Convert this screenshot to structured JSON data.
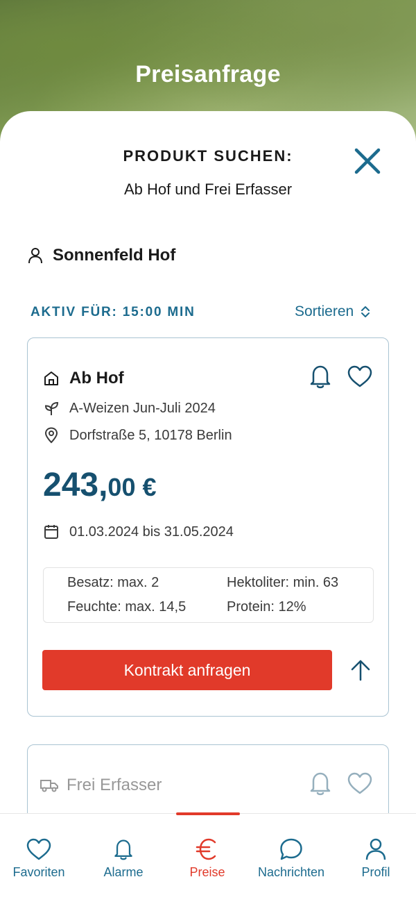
{
  "header": {
    "title": "Preisanfrage"
  },
  "search": {
    "heading": "PRODUKT SUCHEN:",
    "subtitle": "Ab Hof und Frei Erfasser"
  },
  "farm": {
    "name": "Sonnenfeld Hof"
  },
  "status": {
    "active_label": "AKTIV FÜR: 15:00 MIN",
    "sort_label": "Sortieren"
  },
  "offers": [
    {
      "title": "Ab Hof",
      "product": "A-Weizen Jun-Juli 2024",
      "address": "Dorfstraße 5, 10178 Berlin",
      "price_main": "243,",
      "price_cents": "00 €",
      "period": "01.03.2024 bis 31.05.2024",
      "specs": [
        "Besatz: max. 2",
        "Hektoliter: min. 63",
        "Feuchte: max. 14,5",
        "Protein: 12%"
      ],
      "cta": "Kontrakt anfragen"
    },
    {
      "title": "Frei Erfasser"
    }
  ],
  "nav": {
    "items": [
      {
        "label": "Favoriten",
        "icon": "heart-icon"
      },
      {
        "label": "Alarme",
        "icon": "bell-icon"
      },
      {
        "label": "Preise",
        "icon": "euro-icon"
      },
      {
        "label": "Nachrichten",
        "icon": "chat-icon"
      },
      {
        "label": "Profil",
        "icon": "user-icon"
      }
    ],
    "active": "Preise"
  },
  "colors": {
    "accent": "#1c6b8e",
    "price": "#16506f",
    "cta": "#e13a2a"
  }
}
